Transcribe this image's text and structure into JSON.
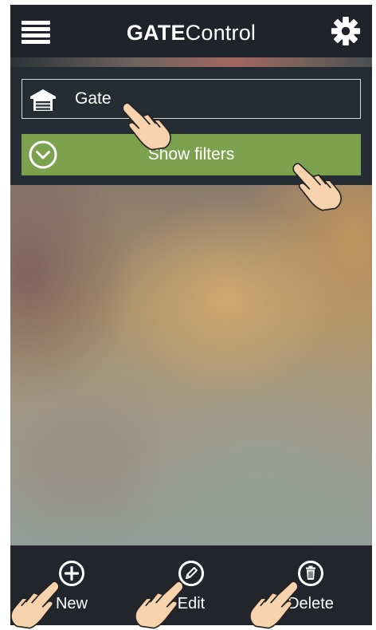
{
  "header": {
    "title_bold": "GATE",
    "title_light": "Control",
    "menu_icon": "hamburger-menu-icon",
    "settings_icon": "gear-icon"
  },
  "device": {
    "icon": "garage-door-icon",
    "label": "Gate"
  },
  "filters": {
    "icon": "chevron-down-circle-icon",
    "label": "Show filters",
    "color": "#7da24f"
  },
  "toolbar": {
    "new_label": "New",
    "new_icon": "plus-circle-icon",
    "edit_label": "Edit",
    "edit_icon": "pencil-circle-icon",
    "delete_label": "Delete",
    "delete_icon": "trash-circle-icon"
  },
  "overlay": {
    "hint_icon": "tap-hand-icon"
  },
  "colors": {
    "header_bg": "#202329",
    "bar_bg": "#22262c",
    "accent_green": "#7da24f",
    "text": "#ffffff"
  }
}
